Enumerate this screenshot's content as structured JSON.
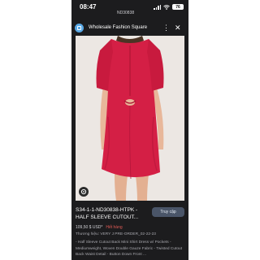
{
  "status_bar": {
    "time": "08:47",
    "url": "ND30838",
    "battery": "76"
  },
  "header": {
    "title": "Wholesale Fashion Square",
    "more_icon": "more-vertical-icon",
    "close_icon": "close-icon"
  },
  "product": {
    "image_icon": "zoom-lens-icon",
    "title": "S34-1-1-ND30838-HTPK -\nHALF SLEEVE CUTOUT...",
    "button_label": "Truy cập",
    "price": "109,50 $ USD*",
    "stock": "Hết hàng",
    "brand": "Thương hiệu: VERY J PRE-ORDER_02-22-23",
    "description": "- Half Sleeve Cutout Back Mini Shirt Dress w/ Pockets - Mediumweight, Woven Double Gauze Fabric - Twisted Cutout Back Waist Detail - Button Down Front ..."
  },
  "colors": {
    "background": "#1c1c1e",
    "dress": "#d41f45",
    "stock": "#e05a55",
    "button": "#4a5568"
  }
}
